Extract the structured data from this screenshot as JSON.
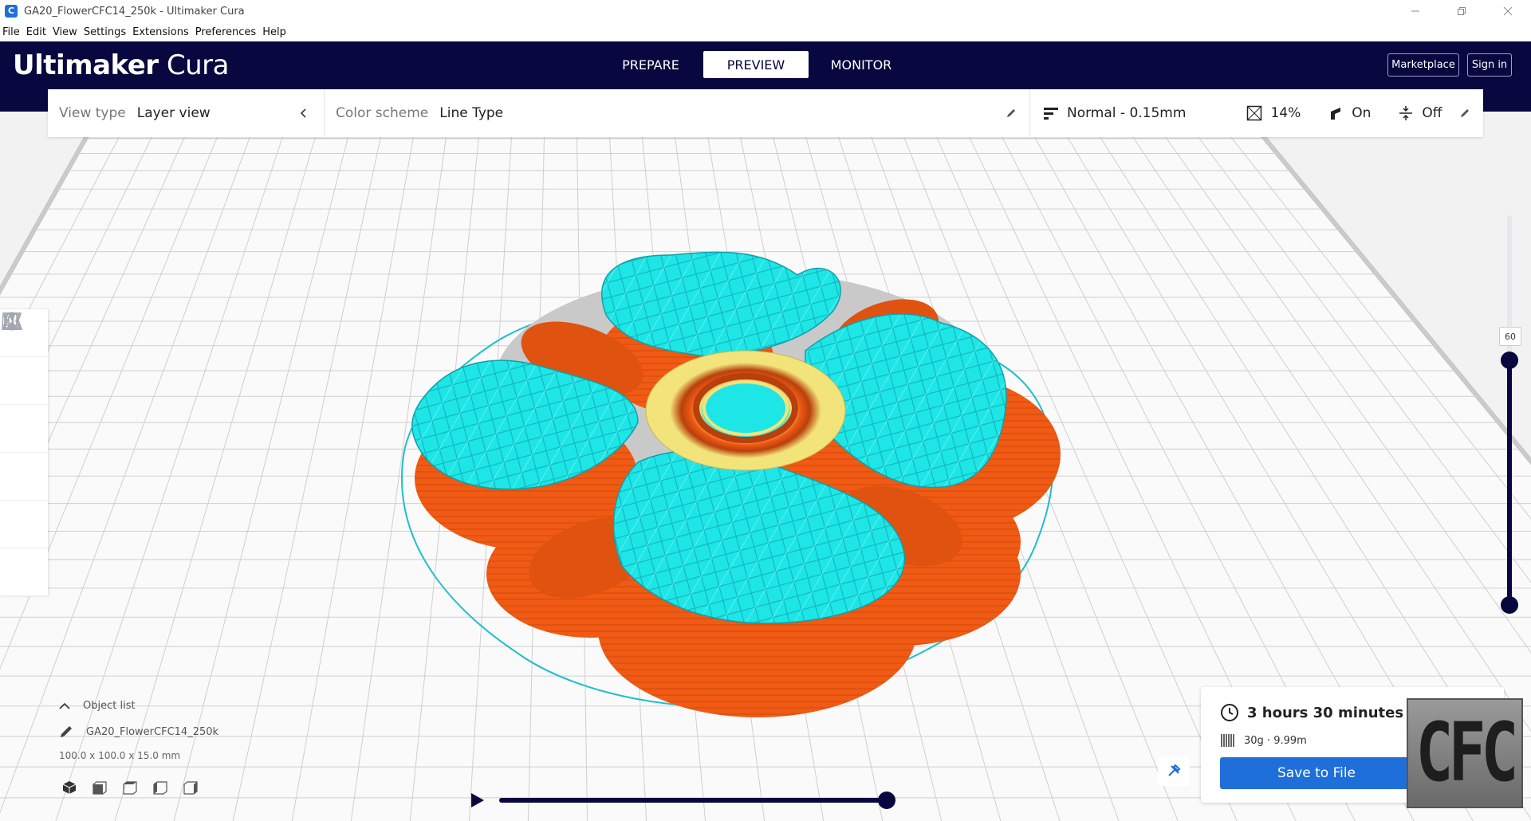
{
  "window": {
    "title": "GA20_FlowerCFC14_250k - Ultimaker Cura",
    "app_icon_letter": "C",
    "controls": [
      "minimize-icon",
      "restore-icon",
      "close-icon"
    ]
  },
  "menu": [
    "File",
    "Edit",
    "View",
    "Settings",
    "Extensions",
    "Preferences",
    "Help"
  ],
  "header": {
    "logo_bold": "Ultimaker",
    "logo_light": "Cura",
    "tabs": [
      {
        "label": "PREPARE",
        "active": false
      },
      {
        "label": "PREVIEW",
        "active": true
      },
      {
        "label": "MONITOR",
        "active": false
      }
    ],
    "marketplace": "Marketplace",
    "sign_in": "Sign in"
  },
  "view_bar": {
    "view_type_label": "View type",
    "view_type_value": "Layer view",
    "color_scheme_label": "Color scheme",
    "color_scheme_value": "Line Type",
    "profile": "Normal - 0.15mm",
    "infill": "14%",
    "support": "On",
    "adhesion": "Off"
  },
  "left_tools": [
    "move-tool-icon",
    "scale-tool-icon",
    "rotate-tool-icon",
    "mirror-tool-icon",
    "per-model-settings-icon",
    "support-blocker-icon"
  ],
  "object_list": {
    "header": "Object list",
    "object_name": "GA20_FlowerCFC14_250k",
    "dimensions": "100.0 x 100.0 x 15.0 mm",
    "view_buttons": [
      "3d-view-icon",
      "front-view-icon",
      "top-view-icon",
      "left-view-icon",
      "right-view-icon"
    ]
  },
  "layer_slider": {
    "current_layer": "60",
    "progress": 1.0
  },
  "simulation": {
    "progress": 1.0
  },
  "print_info": {
    "time": "3 hours 30 minutes",
    "material": "30g · 9.99m",
    "save_button": "Save to File"
  },
  "watermark_text": "CFC",
  "colors": {
    "header_bg": "#08073f",
    "accent_blue": "#1e6fd9",
    "wall_orange": "#f05a14",
    "infill_cyan": "#1ee6e6",
    "skin_yellow": "#f2e37a"
  }
}
